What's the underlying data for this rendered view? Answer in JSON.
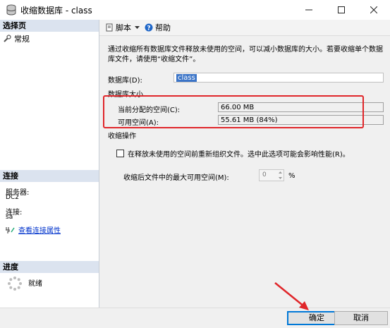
{
  "window": {
    "title": "收缩数据库 - class"
  },
  "left_pane": {
    "select_page_header": "选择页",
    "pages": [
      {
        "label": "常规"
      }
    ],
    "connection_header": "连接",
    "server_label": "服务器:",
    "server_value": "DC2",
    "connection_label": "连接:",
    "connection_value": "sa",
    "view_props_link": "查看连接属性",
    "progress_header": "进度",
    "progress_status": "就绪"
  },
  "toolbar": {
    "script_label": "脚本",
    "help_label": "帮助"
  },
  "main": {
    "description": "通过收缩所有数据库文件释放未使用的空间，可以减小数据库的大小。若要收缩单个数据库文件，请使用“收缩文件”。",
    "database_label": "数据库(D):",
    "database_value": "class",
    "db_size_header": "数据库大小",
    "allocated_label": "当前分配的空间(C):",
    "allocated_value": "66.00 MB",
    "available_label": "可用空间(A):",
    "available_value": "55.61 MB (84%)",
    "shrink_action_header": "收缩操作",
    "reorganize_label": "在释放未使用的空间前重新组织文件。选中此选项可能会影响性能(R)。",
    "reorganize_checked": false,
    "max_free_label": "收缩后文件中的最大可用空间(M):",
    "max_free_value": "0",
    "max_free_unit": "%"
  },
  "buttons": {
    "ok": "确定",
    "cancel": "取消"
  },
  "colors": {
    "highlight_box": "#e0262a",
    "arrow": "#e0262a",
    "section_header": "#dbe3ef",
    "link": "#0033cc"
  }
}
